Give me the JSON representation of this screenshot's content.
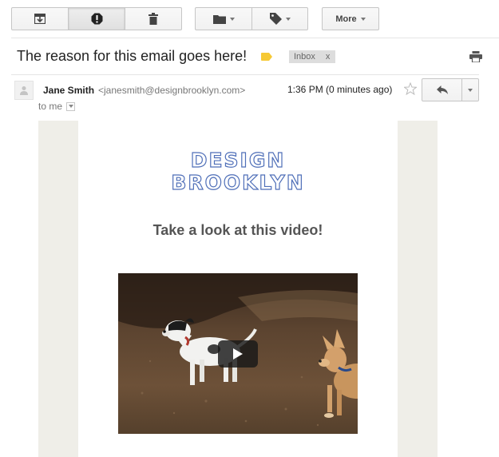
{
  "toolbar": {
    "more_label": "More"
  },
  "message": {
    "subject": "The reason for this email goes here!",
    "label": "Inbox",
    "label_remove": "x",
    "sender_name": "Jane Smith",
    "sender_email": "<janesmith@designbrooklyn.com>",
    "timestamp": "1:36 PM (0 minutes ago)",
    "recipient": "to me"
  },
  "email_body": {
    "logo_line1": "DESIGN",
    "logo_line2": "BROOKLYN",
    "headline": "Take a look at this video!"
  },
  "colors": {
    "logo_blue": "#4f6fb8",
    "label_yellow": "#f6c935",
    "body_background": "#efeee8"
  },
  "icons": [
    "archive-icon",
    "report-spam-icon",
    "delete-icon",
    "folder-icon",
    "label-icon",
    "print-icon",
    "avatar-icon",
    "star-icon",
    "reply-icon",
    "play-icon"
  ]
}
